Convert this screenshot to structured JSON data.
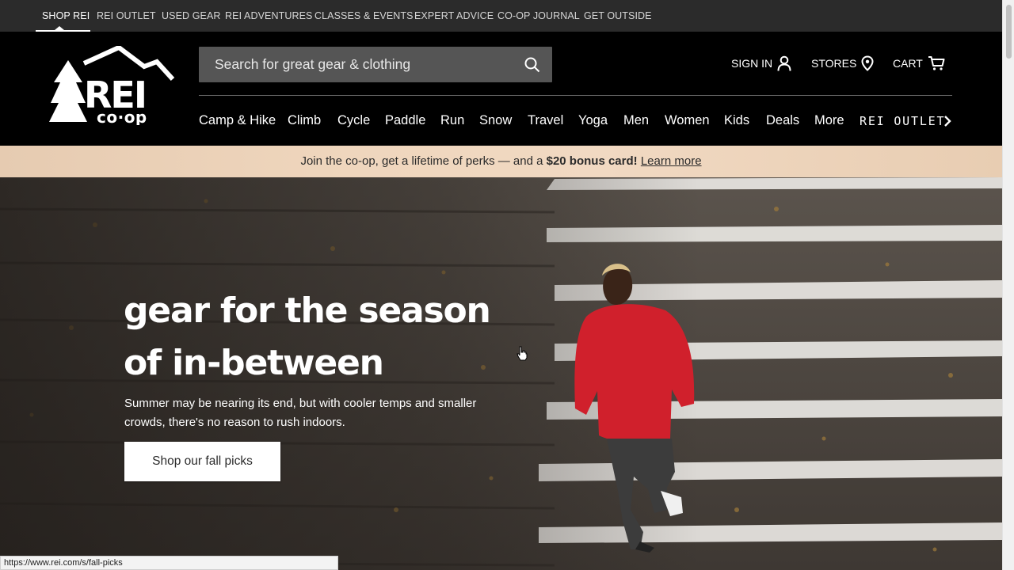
{
  "utility_bar": {
    "links": [
      "SHOP REI",
      "REI OUTLET",
      "USED GEAR",
      "REI ADVENTURES",
      "CLASSES & EVENTS",
      "EXPERT ADVICE",
      "CO-OP JOURNAL",
      "GET OUTSIDE"
    ],
    "active_index": 0
  },
  "header": {
    "logo_text": "REI co-op",
    "search": {
      "placeholder": "Search for great gear & clothing",
      "value": "",
      "icon": "search-icon"
    },
    "account": [
      {
        "label": "SIGN IN",
        "icon": "person-icon"
      },
      {
        "label": "STORES",
        "icon": "location-pin-icon"
      },
      {
        "label": "CART",
        "icon": "cart-icon"
      }
    ],
    "nav": [
      "Camp & Hike",
      "Climb",
      "Cycle",
      "Paddle",
      "Run",
      "Snow",
      "Travel",
      "Yoga",
      "Men",
      "Women",
      "Kids",
      "Deals",
      "More",
      "REI OUTLET"
    ],
    "nav_more_icon": "chevron-right-icon"
  },
  "banner": {
    "text": "Join the co-op, get a lifetime of perks — and a",
    "bold": "$20 bonus card!",
    "link": "Learn more"
  },
  "hero": {
    "title_line1": "gear for the season",
    "title_line2": "of in-between",
    "subtitle": "Summer may be nearing its end, but with cooler temps and smaller crowds, there's no reason to rush indoors.",
    "cta": "Shop our fall picks"
  },
  "status_bar": {
    "url": "https://www.rei.com/s/fall-picks"
  },
  "colors": {
    "brand_black": "#000000",
    "utility_bar": "#2b2b2b",
    "search_bg": "#555555",
    "banner": "#efd6bd",
    "jacket_red": "#d0202c"
  }
}
